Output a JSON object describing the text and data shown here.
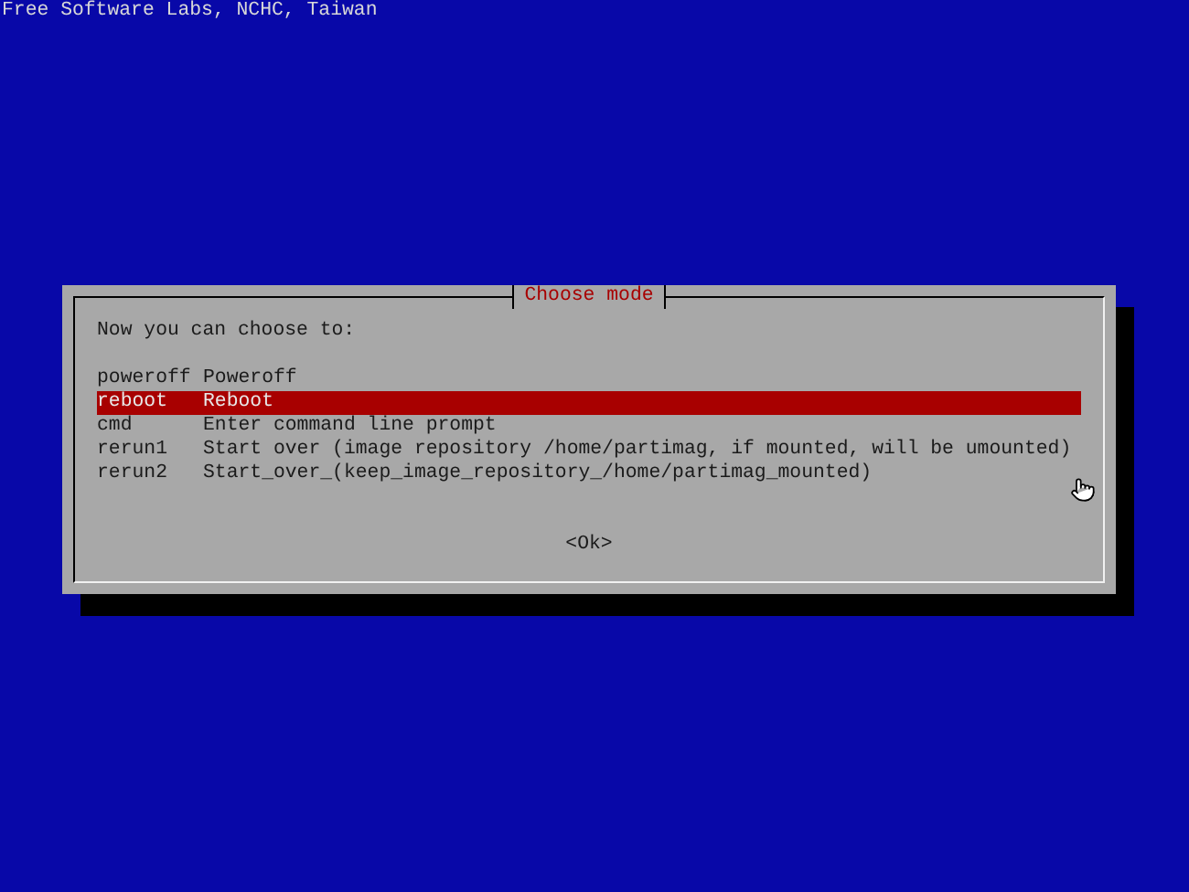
{
  "header": "Free Software Labs, NCHC, Taiwan",
  "dialog": {
    "title": "Choose mode",
    "prompt": "Now you can choose to:",
    "items": [
      {
        "key": "poweroff",
        "label": "Poweroff",
        "selected": false
      },
      {
        "key": "reboot",
        "label": "Reboot",
        "selected": true
      },
      {
        "key": "cmd",
        "label": "Enter command line prompt",
        "selected": false
      },
      {
        "key": "rerun1",
        "label": "Start over (image repository /home/partimag, if mounted, will be umounted)",
        "selected": false
      },
      {
        "key": "rerun2",
        "label": "Start_over_(keep_image_repository_/home/partimag_mounted)",
        "selected": false
      }
    ],
    "button": "<Ok>"
  }
}
